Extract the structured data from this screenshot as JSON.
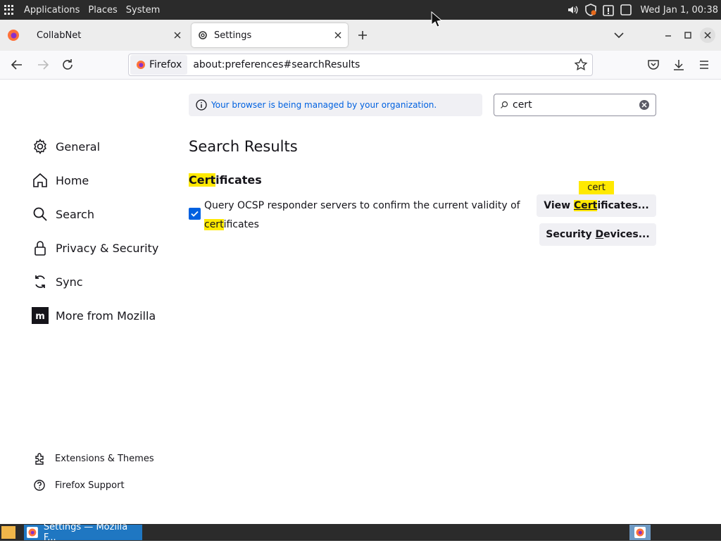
{
  "top_panel": {
    "menus": [
      "Applications",
      "Places",
      "System"
    ],
    "clock": "Wed Jan 1, 00:38",
    "tray_icons": [
      "volume-icon",
      "shield-update-icon",
      "alert-clipboard-icon",
      "window-icon"
    ]
  },
  "tabs": [
    {
      "label": "CollabNet",
      "active": false
    },
    {
      "label": "Settings",
      "active": true
    }
  ],
  "navbar": {
    "identity_label": "Firefox",
    "url": "about:preferences#searchResults"
  },
  "prefs": {
    "policy_notice": "Your browser is being managed by your organization.",
    "search_query": "cert",
    "categories": [
      {
        "label": "General",
        "icon": "gear-icon"
      },
      {
        "label": "Home",
        "icon": "home-icon"
      },
      {
        "label": "Search",
        "icon": "search-icon"
      },
      {
        "label": "Privacy & Security",
        "icon": "lock-icon"
      },
      {
        "label": "Sync",
        "icon": "sync-icon"
      },
      {
        "label": "More from Mozilla",
        "icon": "mozilla-icon"
      }
    ],
    "footer_links": [
      {
        "label": "Extensions & Themes",
        "icon": "puzzle-icon"
      },
      {
        "label": "Firefox Support",
        "icon": "help-icon"
      }
    ],
    "results_title": "Search Results",
    "section": {
      "heading_hl": "Cert",
      "heading_rest": "ificates",
      "ocsp_text": "Query OCSP responder servers to confirm the current validity of ",
      "ocsp_hl": "cert",
      "ocsp_rest": "ificates",
      "ocsp_checked": true,
      "view_certs_pre": "View ",
      "view_certs_hl": "Cert",
      "view_certs_post": "ificates...",
      "sec_devices_pre": "Security ",
      "sec_devices_ul": "D",
      "sec_devices_post": "evices...",
      "tooltip": "cert"
    }
  },
  "taskbar": {
    "window_title": "Settings — Mozilla F..."
  },
  "colors": {
    "accent": "#0061e0",
    "highlight": "#ffe900",
    "panel": "#2b2b2b"
  }
}
